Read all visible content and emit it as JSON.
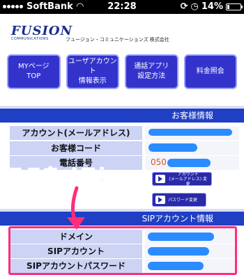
{
  "status_bar": {
    "carrier": "SoftBank",
    "time": "22:28",
    "battery": "14%",
    "battery_level": 0.14
  },
  "header": {
    "logo_main": "FUSION",
    "logo_sub": "COMMUNICATIONS",
    "company": "フュージョン・コミュニケーションズ 株式会社"
  },
  "nav": [
    {
      "label": "MYページ\nTOP"
    },
    {
      "label": "ユーザアカウント\n情報表示"
    },
    {
      "label": "通話アプリ\n設定方法"
    },
    {
      "label": "料金照会"
    }
  ],
  "customer_section": {
    "title": "お客様情報",
    "rows": [
      {
        "label": "アカウント(メールアドレス)"
      },
      {
        "label": "お客様コード"
      },
      {
        "label": "電話番号",
        "value_prefix": "050"
      }
    ]
  },
  "actions": {
    "account_change": "アカウント\n(メールアドレス) 変更",
    "password_change": "パスワード変更"
  },
  "annotation": "ここをメモ！",
  "sip_section": {
    "title": "SIPアカウント情報",
    "rows": [
      {
        "label": "ドメイン"
      },
      {
        "label": "SIPアカウント"
      },
      {
        "label": "SIPアカウントパスワード"
      }
    ]
  },
  "colors": {
    "nav_button": "#3333cc",
    "section_bar": "#1f3fc4",
    "label_bg": "#ccd3f5",
    "annotation": "#ff2d7a",
    "redaction": "#2a8cff"
  }
}
